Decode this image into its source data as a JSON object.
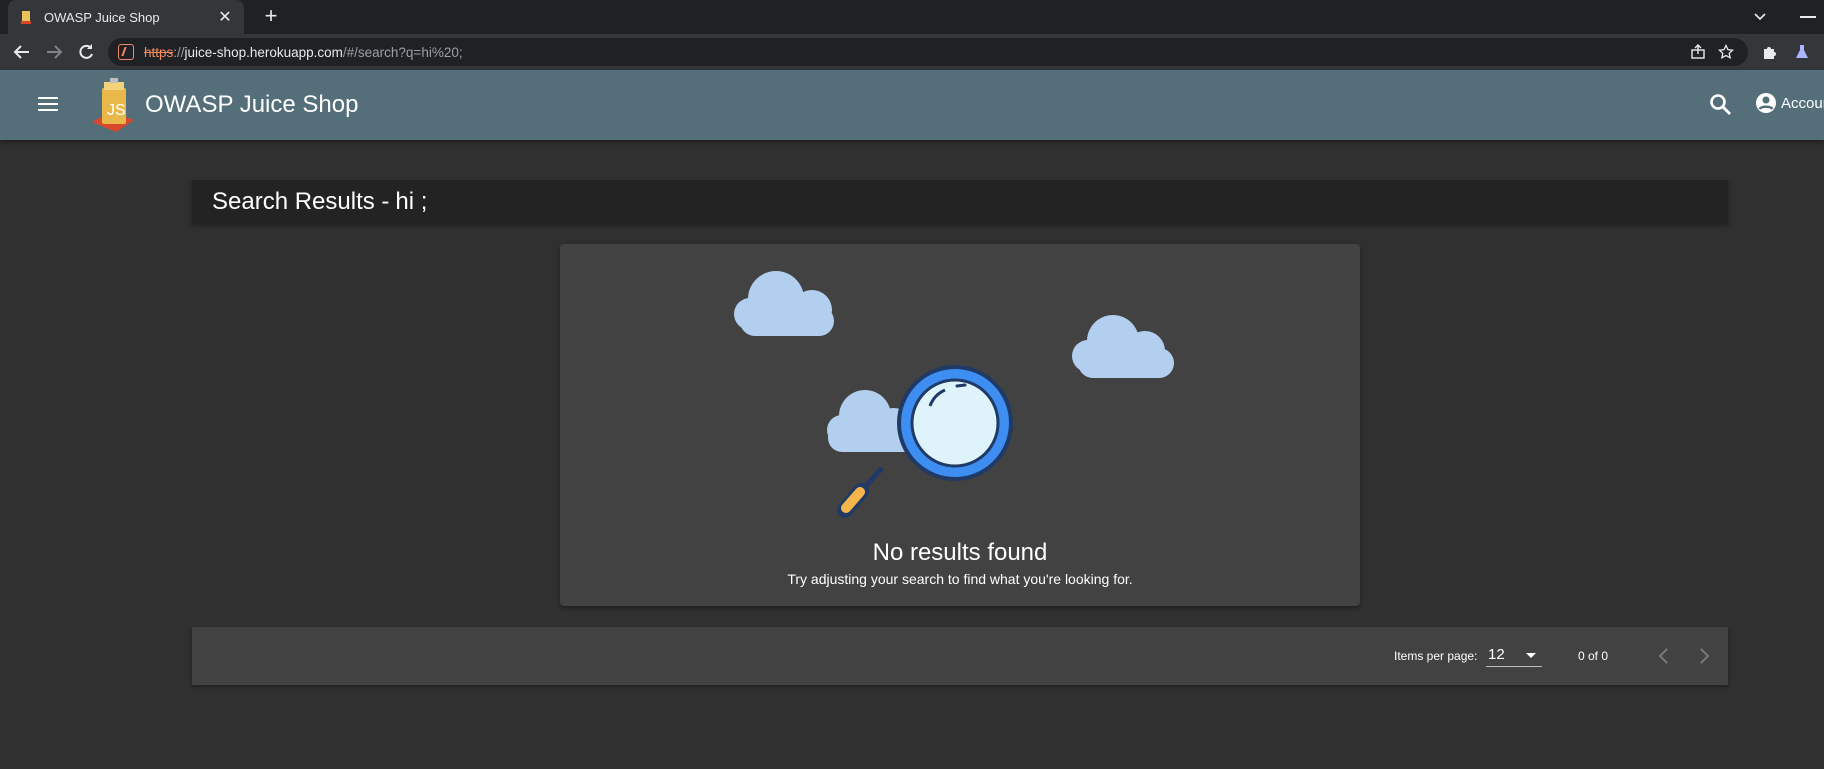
{
  "browser": {
    "tab_title": "OWASP Juice Shop",
    "tab_close": "✕",
    "new_tab": "+",
    "url_scheme": "https",
    "url_sep": "://",
    "url_host": "juice-shop.herokuapp.com",
    "url_path": "/#/search?q=hi%20;"
  },
  "header": {
    "title": "OWASP Juice Shop",
    "account_label": "Account"
  },
  "search": {
    "heading_prefix": "Search Results -",
    "query": "hi ;"
  },
  "empty_state": {
    "title": "No results found",
    "subtitle": "Try adjusting your search to find what you're looking for."
  },
  "paginator": {
    "items_per_page_label": "Items per page:",
    "items_per_page_value": "12",
    "range_label": "0 of 0"
  },
  "colors": {
    "app_bar": "#546e7a",
    "background": "#303030",
    "card": "#424242",
    "cloud": "#b3cff0",
    "lens_ring": "#3d8ef0",
    "handle": "#f5b54a"
  },
  "icons": [
    "menu-icon",
    "juice-shop-logo",
    "search-icon",
    "account-circle-icon",
    "chevron-left-icon",
    "chevron-right-icon",
    "magnifier-illustration",
    "cloud-illustration"
  ]
}
